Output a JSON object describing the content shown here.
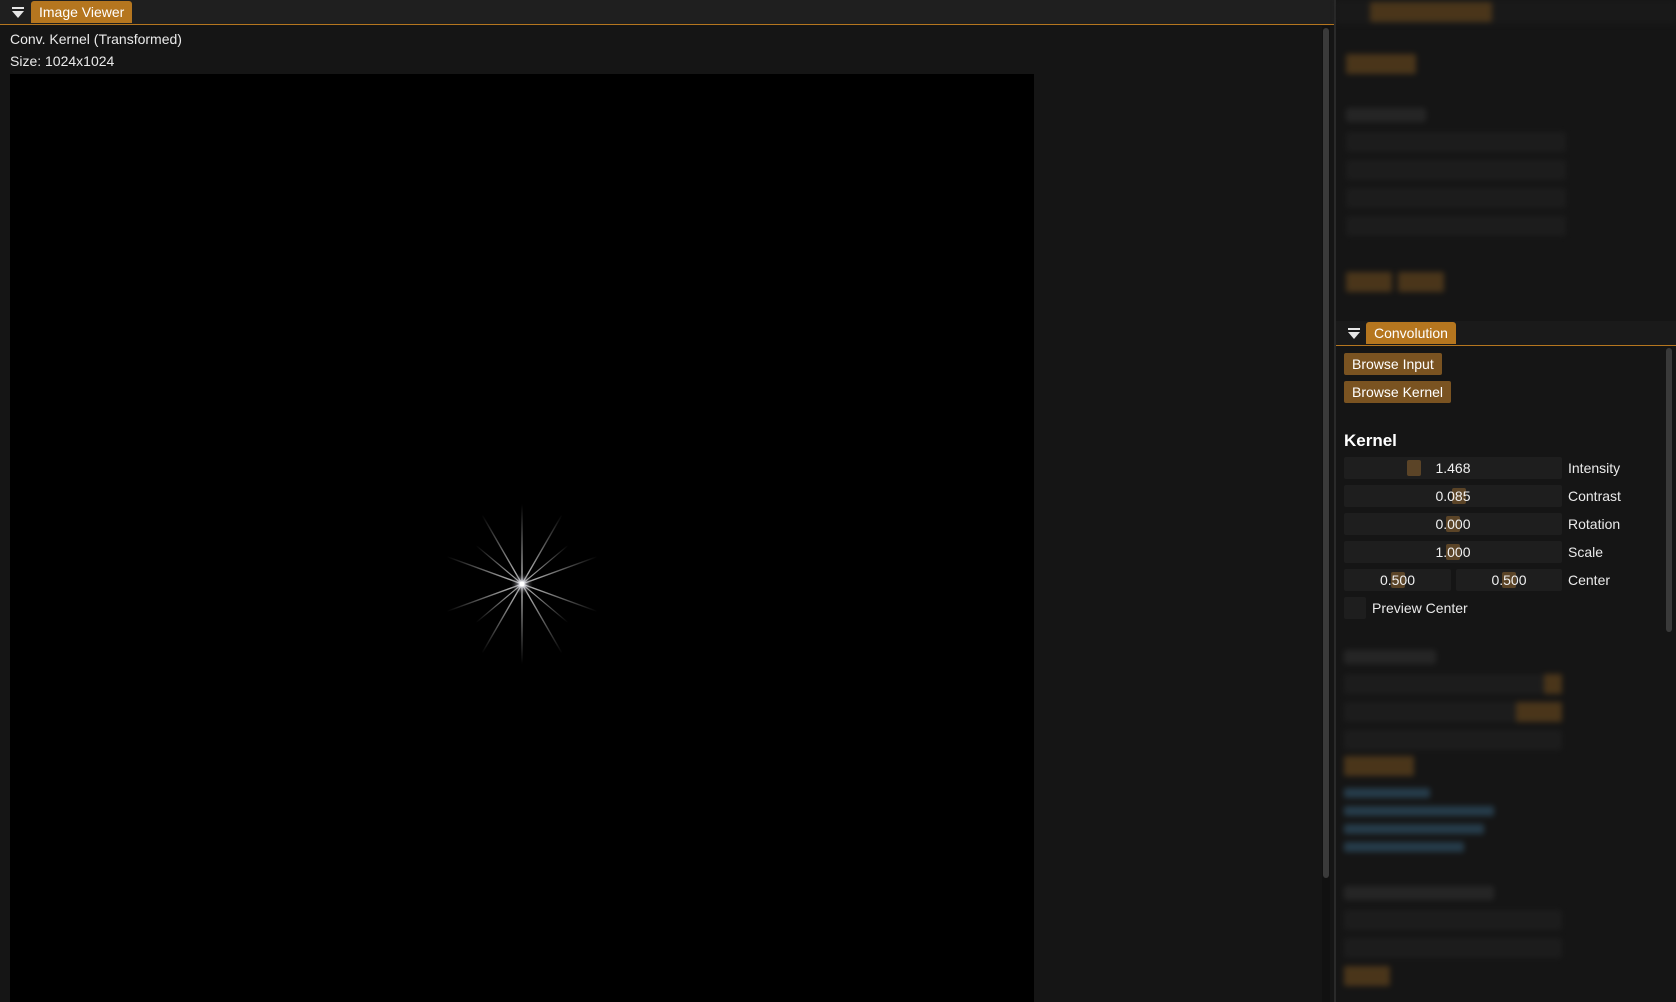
{
  "viewer": {
    "tab_label": "Image Viewer",
    "image_name": "Conv. Kernel (Transformed)",
    "image_size": "Size: 1024x1024"
  },
  "convolution": {
    "tab_label": "Convolution",
    "browse_input": "Browse Input",
    "browse_kernel": "Browse Kernel",
    "kernel_title": "Kernel",
    "intensity": {
      "label": "Intensity",
      "value": "1.468"
    },
    "contrast": {
      "label": "Contrast",
      "value": "0.085"
    },
    "rotation": {
      "label": "Rotation",
      "value": "0.000"
    },
    "scale": {
      "label": "Scale",
      "value": "1.000"
    },
    "center": {
      "label": "Center",
      "x": "0.500",
      "y": "0.500"
    },
    "preview_center": "Preview Center"
  },
  "colors": {
    "accent": "#b5761f",
    "button": "#7a5321",
    "panel": "#151515"
  }
}
